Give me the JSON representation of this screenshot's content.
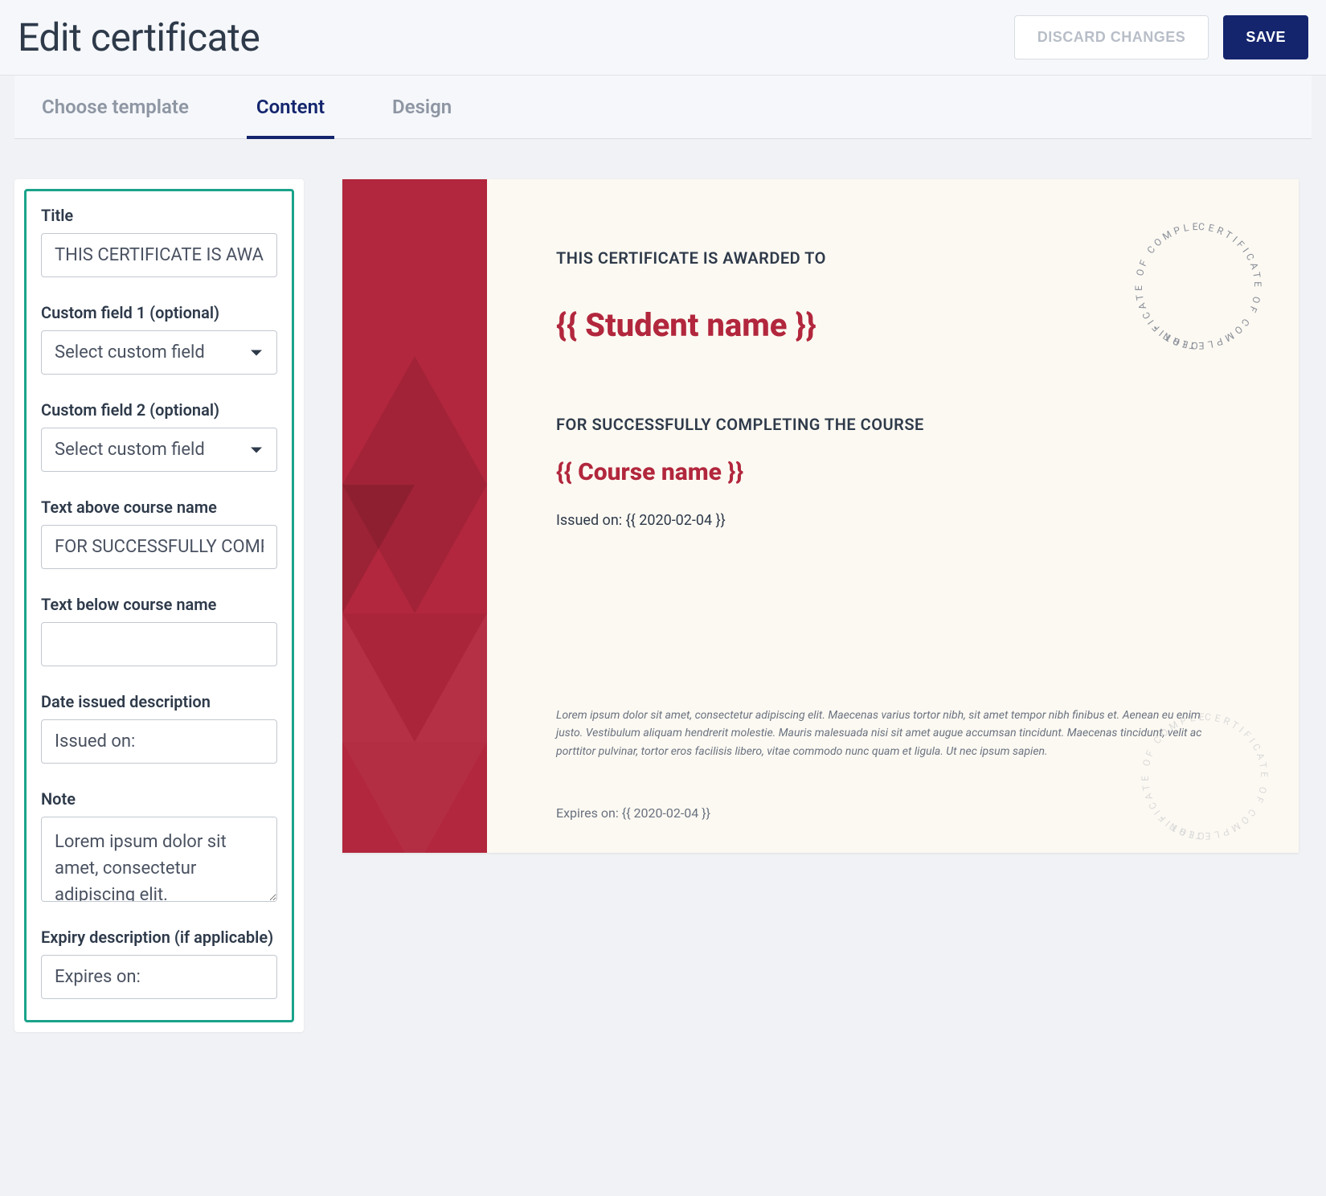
{
  "header": {
    "title": "Edit certificate",
    "discard_label": "DISCARD CHANGES",
    "save_label": "SAVE"
  },
  "tabs": {
    "choose_template": "Choose template",
    "content": "Content",
    "design": "Design"
  },
  "form": {
    "title_label": "Title",
    "title_value": "THIS CERTIFICATE IS AWARDED TO",
    "custom1_label": "Custom field 1 (optional)",
    "custom1_value": "Select custom field",
    "custom2_label": "Custom field 2 (optional)",
    "custom2_value": "Select custom field",
    "above_label": "Text above course name",
    "above_value": "FOR SUCCESSFULLY COMPLETING THE COURSE",
    "below_label": "Text below course name",
    "below_value": "",
    "date_issued_label": "Date issued description",
    "date_issued_value": "Issued on:",
    "note_label": "Note",
    "note_value": "Lorem ipsum dolor sit amet, consectetur adipiscing elit.",
    "expiry_label": "Expiry description (if applicable)",
    "expiry_value": "Expires on:"
  },
  "preview": {
    "title": "THIS CERTIFICATE IS AWARDED TO",
    "student_name": "{{ Student name }}",
    "above_course": "FOR SUCCESSFULLY COMPLETING THE COURSE",
    "course_name": "{{ Course name }}",
    "issued_on": "Issued on: {{ 2020-02-04 }}",
    "note": "Lorem ipsum dolor sit amet, consectetur adipiscing elit. Maecenas varius tortor nibh, sit amet tempor nibh finibus et. Aenean eu enim justo. Vestibulum aliquam hendrerit molestie. Mauris malesuada nisi sit amet augue accumsan tincidunt. Maecenas tincidunt, velit ac porttitor pulvinar, tortor eros facilisis libero, vitae commodo nunc quam et ligula. Ut nec ipsum sapien.",
    "expires_on": "Expires on: {{ 2020-02-04 }}",
    "seal_text_top": "CERTIFICATE OF COMPLETION  •",
    "seal_text_bottom": "CERTIFICATE OF COMPLETION  •"
  },
  "colors": {
    "accent": "#b2273d",
    "primary": "#14256e",
    "panel_border": "#1aa38a"
  }
}
